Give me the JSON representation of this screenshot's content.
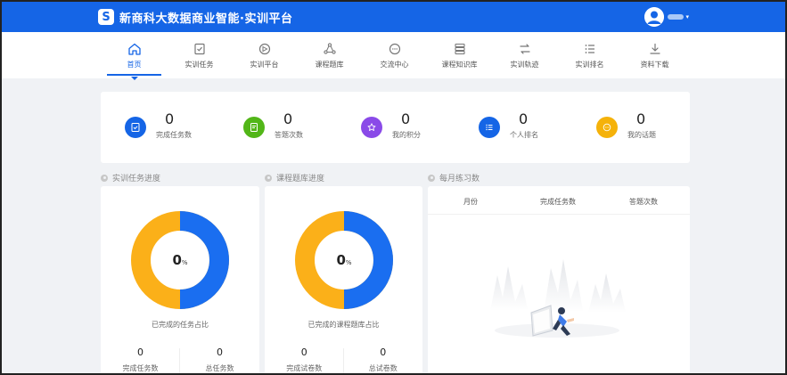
{
  "header": {
    "logo_letter": "S",
    "title": "新商科大数据商业智能·实训平台",
    "user_menu_caret": "▾"
  },
  "nav": {
    "items": [
      {
        "label": "首页",
        "icon": "home-icon",
        "active": true
      },
      {
        "label": "实训任务",
        "icon": "task-icon"
      },
      {
        "label": "实训平台",
        "icon": "platform-icon"
      },
      {
        "label": "课程题库",
        "icon": "question-bank-icon"
      },
      {
        "label": "交流中心",
        "icon": "chat-icon"
      },
      {
        "label": "课程知识库",
        "icon": "knowledge-icon"
      },
      {
        "label": "实训轨迹",
        "icon": "track-icon"
      },
      {
        "label": "实训排名",
        "icon": "ranking-icon"
      },
      {
        "label": "资料下载",
        "icon": "download-icon"
      }
    ]
  },
  "stats": [
    {
      "value": "0",
      "label": "完成任务数",
      "color": "#1565e6",
      "icon": "task-done-icon"
    },
    {
      "value": "0",
      "label": "答题次数",
      "color": "#52b618",
      "icon": "answer-icon"
    },
    {
      "value": "0",
      "label": "我的积分",
      "color": "#8a4ae8",
      "icon": "star-icon"
    },
    {
      "value": "0",
      "label": "个人排名",
      "color": "#1565e6",
      "icon": "list-icon"
    },
    {
      "value": "0",
      "label": "我的话题",
      "color": "#f5b20a",
      "icon": "topic-icon"
    }
  ],
  "sections": {
    "task_progress": "实训任务进度",
    "bank_progress": "课程题库进度",
    "monthly": "每月练习数"
  },
  "task_card": {
    "percent": "0",
    "percent_unit": "%",
    "caption": "已完成的任务占比",
    "left_value": "0",
    "left_label": "完成任务数",
    "right_value": "0",
    "right_label": "总任务数"
  },
  "bank_card": {
    "percent": "0",
    "percent_unit": "%",
    "caption": "已完成的课程题库占比",
    "left_value": "0",
    "left_label": "完成试卷数",
    "right_value": "0",
    "right_label": "总试卷数"
  },
  "monthly_table": {
    "columns": [
      "月份",
      "完成任务数",
      "答题次数"
    ]
  },
  "colors": {
    "primary": "#1565e6",
    "donut_blue": "#1a6ef0",
    "donut_yellow": "#fbb019"
  }
}
